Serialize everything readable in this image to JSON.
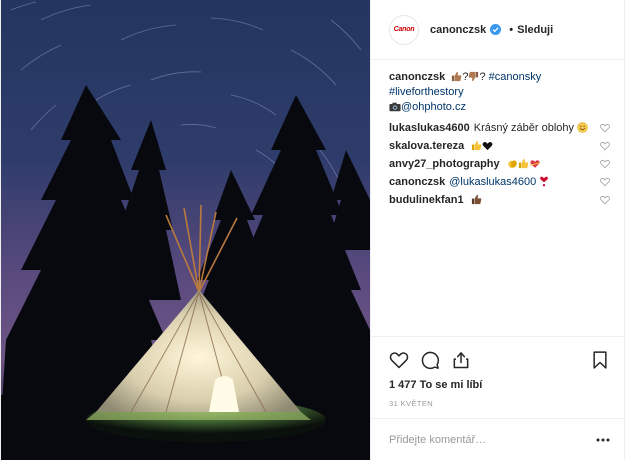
{
  "post": {
    "account": "canonczsk",
    "avatar_text": "Canon",
    "follow_separator": "•",
    "follow_label": "Sleduji",
    "caption": {
      "user": "canonczsk",
      "text_a": "?",
      "text_b": "?",
      "hashtag_1": "#canonsky",
      "hashtag_2": "#liveforthestory",
      "mention": "@ohphoto.cz"
    },
    "comments": [
      {
        "user": "lukaslukas4600",
        "text": "Krásný záběr oblohy"
      },
      {
        "user": "skalova.tereza",
        "text": ""
      },
      {
        "user": "anvy27_photography",
        "text": ""
      },
      {
        "user": "canonczsk",
        "mention": "@lukaslukas4600",
        "text": ""
      },
      {
        "user": "budulinekfan1",
        "text": ""
      }
    ],
    "likes": "1 477 To se mi líbí",
    "date": "31 KVĚTEN",
    "comment_placeholder": "Přidejte komentář…"
  },
  "colors": {
    "text": "#262626",
    "link": "#003569",
    "muted": "#999999",
    "border": "#efefef",
    "verified": "#3897f0",
    "canon_red": "#cc0000"
  },
  "icons": [
    "verified-badge-icon",
    "heart-icon",
    "comment-icon",
    "share-icon",
    "bookmark-icon",
    "more-icon"
  ]
}
